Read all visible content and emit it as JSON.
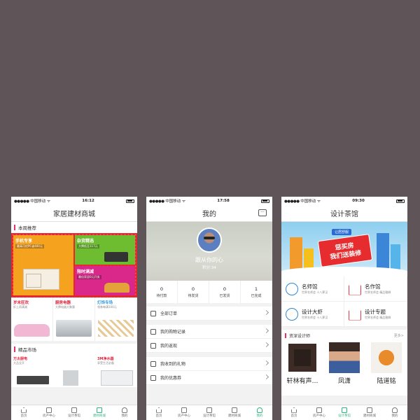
{
  "status": {
    "carrier": "中国移动",
    "times": [
      "16:12",
      "17:58",
      "09:30"
    ]
  },
  "tabs": [
    "首页",
    "房产中心",
    "设计茶馆",
    "建材商城",
    "我的"
  ],
  "phone1": {
    "title": "家居建材商城",
    "weekly": "本周推荐",
    "promos": [
      {
        "title": "手机专享",
        "sub": "最高可优PC省400元"
      },
      {
        "title": "杂货精选",
        "sub": "大牌低至117元"
      },
      {
        "title": "限时满减",
        "sub": "最佳家居0元开卖"
      }
    ],
    "cats": [
      {
        "title": "岁末狂欢",
        "sub": "折上再满减"
      },
      {
        "title": "厨房电器",
        "sub": "大牌电器大聚惠"
      },
      {
        "title": "灯饰专场",
        "sub": "领券每满100元"
      }
    ],
    "market": "精品市场",
    "market_items": [
      {
        "title": "万太厨电",
        "sub": "大品全开"
      },
      {
        "title": "",
        "sub": ""
      },
      {
        "title": "3M净水器",
        "sub": "享受生活必备"
      }
    ]
  },
  "phone2": {
    "title": "我的",
    "name": "跟从你的心",
    "score": "积分:34",
    "orders": [
      {
        "n": "0",
        "l": "待付款"
      },
      {
        "n": "0",
        "l": "待发货"
      },
      {
        "n": "0",
        "l": "已发货"
      },
      {
        "n": "1",
        "l": "已完成"
      }
    ],
    "menu": [
      "全部订单",
      "我的购物记录",
      "我的返现",
      "我收到的礼物",
      "我的优惠券"
    ]
  },
  "phone3": {
    "title": "设计茶馆",
    "banner_tag": "让居舒服",
    "banner_line1": "惩买房",
    "banner_line2": "我们送装修",
    "features": [
      {
        "title": "名师馆",
        "sub": "世界名师会 十八萝汉",
        "icon": "blue"
      },
      {
        "title": "名作馆",
        "sub": "世界名师会 精品雅卿",
        "icon": "red"
      },
      {
        "title": "设计大虾",
        "sub": "世界名师会 十八萝汉",
        "icon": "blue"
      },
      {
        "title": "设计专题",
        "sub": "世界名师会 精品雅卿",
        "icon": "red"
      }
    ],
    "designers_head": "资深设计师",
    "more": "更多>",
    "designers": [
      "轩林有声…",
      "凤潇",
      "陆道铭"
    ]
  }
}
